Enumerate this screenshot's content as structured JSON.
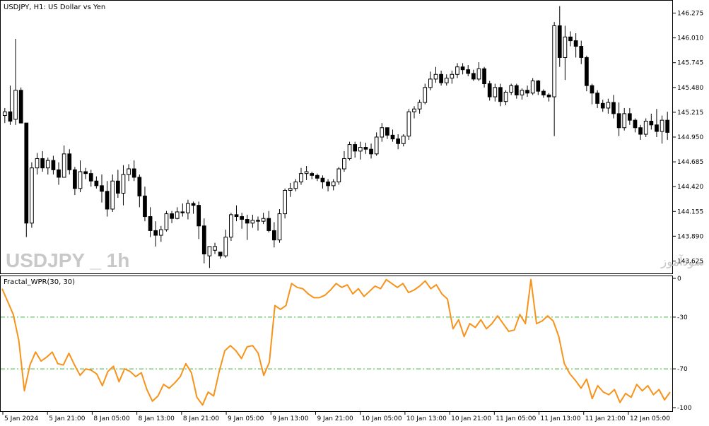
{
  "chart_header": {
    "title": "USDJPY, H1:  US Dollar vs Yen"
  },
  "watermark": {
    "symbol": "USDJPY _ 1h",
    "farsi": "انتشار در سایت سودآموز"
  },
  "indicator": {
    "name": "Fractal_WPR(30, 30)"
  },
  "colors": {
    "bull_fill": "#ffffff",
    "bear_fill": "#000000",
    "wick": "#000000",
    "wpr_line": "#f7931a",
    "level_line": "#3cb043"
  },
  "price_axis": {
    "min": 143.5,
    "max": 146.4,
    "labels": [
      "146.275",
      "146.010",
      "145.745",
      "145.480",
      "145.215",
      "144.950",
      "144.685",
      "144.420",
      "144.155",
      "143.890",
      "143.625"
    ]
  },
  "indicator_axis": {
    "min": -100,
    "max": 0,
    "labels": [
      "0",
      "-30",
      "-70",
      "-100"
    ],
    "levels": [
      -30,
      -70
    ]
  },
  "time_axis": {
    "labels": [
      "5 Jan 2024",
      "5 Jan 21:00",
      "8 Jan 05:00",
      "8 Jan 13:00",
      "8 Jan 21:00",
      "9 Jan 05:00",
      "9 Jan 13:00",
      "9 Jan 21:00",
      "10 Jan 05:00",
      "10 Jan 13:00",
      "10 Jan 21:00",
      "11 Jan 05:00",
      "11 Jan 13:00",
      "11 Jan 21:00",
      "12 Jan 05:00"
    ]
  },
  "chart_data": [
    {
      "type": "candlestick",
      "title": "USDJPY, H1:  US Dollar vs Yen",
      "ylim": [
        143.5,
        146.4
      ],
      "ohlc": [
        [
          145.18,
          145.26,
          145.1,
          145.22
        ],
        [
          145.22,
          145.5,
          145.08,
          145.12
        ],
        [
          145.14,
          146.0,
          145.08,
          145.45
        ],
        [
          145.45,
          145.48,
          145.1,
          145.1
        ],
        [
          145.1,
          145.1,
          143.88,
          144.03
        ],
        [
          144.03,
          144.68,
          143.98,
          144.62
        ],
        [
          144.62,
          144.78,
          144.55,
          144.72
        ],
        [
          144.72,
          144.8,
          144.58,
          144.62
        ],
        [
          144.62,
          144.73,
          144.55,
          144.7
        ],
        [
          144.7,
          144.75,
          144.55,
          144.6
        ],
        [
          144.6,
          144.68,
          144.44,
          144.52
        ],
        [
          144.52,
          144.86,
          144.52,
          144.77
        ],
        [
          144.77,
          144.82,
          144.55,
          144.6
        ],
        [
          144.6,
          144.63,
          144.33,
          144.4
        ],
        [
          144.4,
          144.7,
          144.36,
          144.58
        ],
        [
          144.58,
          144.62,
          144.5,
          144.56
        ],
        [
          144.56,
          144.6,
          144.42,
          144.48
        ],
        [
          144.48,
          144.53,
          144.4,
          144.43
        ],
        [
          144.43,
          144.55,
          144.25,
          144.37
        ],
        [
          144.37,
          144.48,
          144.1,
          144.18
        ],
        [
          144.18,
          144.55,
          144.15,
          144.48
        ],
        [
          144.48,
          144.6,
          144.3,
          144.35
        ],
        [
          144.35,
          144.65,
          144.22,
          144.55
        ],
        [
          144.55,
          144.66,
          144.48,
          144.61
        ],
        [
          144.61,
          144.7,
          144.48,
          144.52
        ],
        [
          144.52,
          144.55,
          144.2,
          144.32
        ],
        [
          144.32,
          144.42,
          144.05,
          144.1
        ],
        [
          144.1,
          144.2,
          143.88,
          143.95
        ],
        [
          143.95,
          144.05,
          143.78,
          143.9
        ],
        [
          143.9,
          144.0,
          143.83,
          143.96
        ],
        [
          143.96,
          144.16,
          143.94,
          144.13
        ],
        [
          144.13,
          144.16,
          144.03,
          144.08
        ],
        [
          144.08,
          144.2,
          144.07,
          144.15
        ],
        [
          144.15,
          144.24,
          144.1,
          144.14
        ],
        [
          144.14,
          144.28,
          144.07,
          144.24
        ],
        [
          144.24,
          144.26,
          144.13,
          144.22
        ],
        [
          144.22,
          144.26,
          143.86,
          144.0
        ],
        [
          144.0,
          144.08,
          143.6,
          143.7
        ],
        [
          143.68,
          143.78,
          143.55,
          143.78
        ],
        [
          143.74,
          143.82,
          143.7,
          143.78
        ],
        [
          143.72,
          143.72,
          143.65,
          143.68
        ],
        [
          143.68,
          143.96,
          143.66,
          143.88
        ],
        [
          143.88,
          144.14,
          143.84,
          144.12
        ],
        [
          144.12,
          144.22,
          144.05,
          144.1
        ],
        [
          144.1,
          144.14,
          143.97,
          144.07
        ],
        [
          144.07,
          144.12,
          143.85,
          144.03
        ],
        [
          144.03,
          144.12,
          143.98,
          144.06
        ],
        [
          144.06,
          144.1,
          143.95,
          144.05
        ],
        [
          144.05,
          144.14,
          144.02,
          144.08
        ],
        [
          144.08,
          144.16,
          143.93,
          143.95
        ],
        [
          143.95,
          144.04,
          143.77,
          143.85
        ],
        [
          143.85,
          144.18,
          143.82,
          144.13
        ],
        [
          144.13,
          144.4,
          144.08,
          144.38
        ],
        [
          144.38,
          144.46,
          144.31,
          144.4
        ],
        [
          144.4,
          144.5,
          144.37,
          144.47
        ],
        [
          144.47,
          144.62,
          144.44,
          144.56
        ],
        [
          144.56,
          144.64,
          144.49,
          144.58
        ],
        [
          144.56,
          144.58,
          144.5,
          144.54
        ],
        [
          144.54,
          144.56,
          144.48,
          144.51
        ],
        [
          144.51,
          144.54,
          144.4,
          144.47
        ],
        [
          144.47,
          144.5,
          144.37,
          144.43
        ],
        [
          144.43,
          144.5,
          144.38,
          144.47
        ],
        [
          144.47,
          144.63,
          144.44,
          144.61
        ],
        [
          144.61,
          144.8,
          144.58,
          144.72
        ],
        [
          144.72,
          144.9,
          144.7,
          144.87
        ],
        [
          144.87,
          144.9,
          144.73,
          144.8
        ],
        [
          144.8,
          144.9,
          144.71,
          144.84
        ],
        [
          144.84,
          144.89,
          144.77,
          144.82
        ],
        [
          144.82,
          144.88,
          144.72,
          144.77
        ],
        [
          144.77,
          145.0,
          144.75,
          144.95
        ],
        [
          144.95,
          145.1,
          144.9,
          145.05
        ],
        [
          145.05,
          145.05,
          144.93,
          144.97
        ],
        [
          144.97,
          145.03,
          144.9,
          144.93
        ],
        [
          144.93,
          144.98,
          144.82,
          144.88
        ],
        [
          144.88,
          144.98,
          144.85,
          144.96
        ],
        [
          144.96,
          145.25,
          144.92,
          145.22
        ],
        [
          145.22,
          145.28,
          145.15,
          145.25
        ],
        [
          145.25,
          145.35,
          145.2,
          145.32
        ],
        [
          145.32,
          145.52,
          145.3,
          145.48
        ],
        [
          145.48,
          145.65,
          145.45,
          145.57
        ],
        [
          145.57,
          145.7,
          145.53,
          145.62
        ],
        [
          145.62,
          145.66,
          145.5,
          145.53
        ],
        [
          145.53,
          145.62,
          145.5,
          145.58
        ],
        [
          145.58,
          145.66,
          145.52,
          145.62
        ],
        [
          145.62,
          145.74,
          145.58,
          145.7
        ],
        [
          145.7,
          145.74,
          145.62,
          145.67
        ],
        [
          145.67,
          145.72,
          145.6,
          145.63
        ],
        [
          145.63,
          145.67,
          145.55,
          145.57
        ],
        [
          145.57,
          145.75,
          145.55,
          145.68
        ],
        [
          145.68,
          145.7,
          145.48,
          145.52
        ],
        [
          145.52,
          145.55,
          145.34,
          145.38
        ],
        [
          145.38,
          145.52,
          145.33,
          145.48
        ],
        [
          145.48,
          145.52,
          145.28,
          145.33
        ],
        [
          145.33,
          145.45,
          145.29,
          145.43
        ],
        [
          145.43,
          145.52,
          145.4,
          145.5
        ],
        [
          145.5,
          145.52,
          145.36,
          145.4
        ],
        [
          145.4,
          145.47,
          145.35,
          145.45
        ],
        [
          145.45,
          145.5,
          145.38,
          145.42
        ],
        [
          145.42,
          145.58,
          145.4,
          145.55
        ],
        [
          145.55,
          145.56,
          145.4,
          145.44
        ],
        [
          145.44,
          145.46,
          145.37,
          145.4
        ],
        [
          145.4,
          145.42,
          145.33,
          145.38
        ],
        [
          145.38,
          146.18,
          144.96,
          146.14
        ],
        [
          146.14,
          146.35,
          145.7,
          145.8
        ],
        [
          145.8,
          146.14,
          145.56,
          146.02
        ],
        [
          146.02,
          146.08,
          145.92,
          145.98
        ],
        [
          145.98,
          146.06,
          145.8,
          145.92
        ],
        [
          145.92,
          145.98,
          145.73,
          145.8
        ],
        [
          145.8,
          145.82,
          145.44,
          145.5
        ],
        [
          145.5,
          145.52,
          145.3,
          145.42
        ],
        [
          145.42,
          145.45,
          145.26,
          145.31
        ],
        [
          145.31,
          145.35,
          145.22,
          145.26
        ],
        [
          145.26,
          145.36,
          145.2,
          145.32
        ],
        [
          145.32,
          145.4,
          145.15,
          145.2
        ],
        [
          145.2,
          145.32,
          144.96,
          145.05
        ],
        [
          145.05,
          145.26,
          145.02,
          145.2
        ],
        [
          145.2,
          145.26,
          145.08,
          145.13
        ],
        [
          145.13,
          145.15,
          145.0,
          145.05
        ],
        [
          145.05,
          145.08,
          144.92,
          144.98
        ],
        [
          144.98,
          145.15,
          144.95,
          145.12
        ],
        [
          145.12,
          145.2,
          145.03,
          145.08
        ],
        [
          145.08,
          145.25,
          144.95,
          145.01
        ],
        [
          145.01,
          145.18,
          144.88,
          145.13
        ],
        [
          145.13,
          145.22,
          144.92,
          145.0
        ]
      ]
    },
    {
      "type": "line",
      "title": "Fractal_WPR(30, 30)",
      "ylim": [
        -100,
        0
      ],
      "levels": [
        -30,
        -70
      ],
      "series": [
        {
          "values": [
            -8,
            -18,
            -28,
            -48,
            -87,
            -67,
            -57,
            -64,
            -61,
            -57,
            -66,
            -67,
            -58,
            -67,
            -75,
            -70,
            -71,
            -74,
            -83,
            -72,
            -68,
            -80,
            -70,
            -72,
            -76,
            -73,
            -86,
            -95,
            -91,
            -82,
            -85,
            -81,
            -76,
            -66,
            -73,
            -92,
            -98,
            -88,
            -91,
            -72,
            -56,
            -52,
            -56,
            -62,
            -53,
            -52,
            -58,
            -75,
            -65,
            -21,
            -24,
            -21,
            -4,
            -7,
            -8,
            -12,
            -15,
            -15,
            -13,
            -9,
            -4,
            -7,
            -5,
            -12,
            -8,
            -14,
            -10,
            -6,
            -8,
            -1,
            -4,
            -7,
            -4,
            -11,
            -9,
            -6,
            -2,
            -8,
            -5,
            -12,
            -16,
            -39,
            -32,
            -45,
            -35,
            -38,
            -32,
            -39,
            -35,
            -29,
            -35,
            -41,
            -40,
            -28,
            -35,
            -1,
            -35,
            -33,
            -29,
            -33,
            -45,
            -66,
            -74,
            -79,
            -85,
            -78,
            -93,
            -83,
            -88,
            -90,
            -86,
            -96,
            -89,
            -92,
            -82,
            -87,
            -83,
            -90,
            -86,
            -94,
            -88
          ]
        }
      ]
    }
  ]
}
